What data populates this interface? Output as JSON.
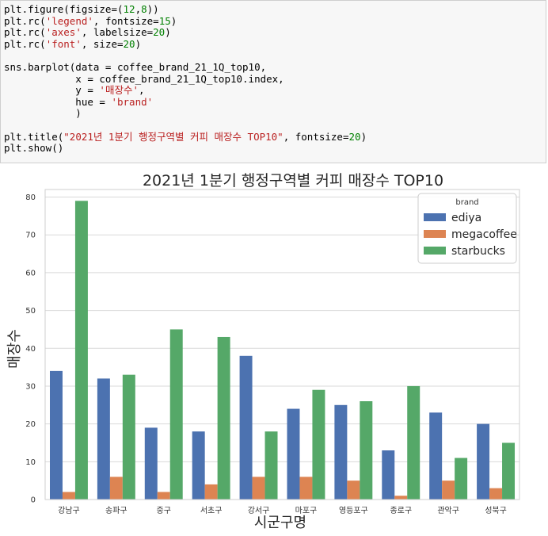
{
  "code_cell": {
    "lines": [
      [
        {
          "t": "plt.figure(figsize=("
        },
        {
          "t": "12",
          "c": "num"
        },
        {
          "t": ","
        },
        {
          "t": "8",
          "c": "num"
        },
        {
          "t": "))"
        }
      ],
      [
        {
          "t": "plt.rc("
        },
        {
          "t": "'legend'",
          "c": "str"
        },
        {
          "t": ", fontsize="
        },
        {
          "t": "15",
          "c": "num"
        },
        {
          "t": ")"
        }
      ],
      [
        {
          "t": "plt.rc("
        },
        {
          "t": "'axes'",
          "c": "str"
        },
        {
          "t": ", labelsize="
        },
        {
          "t": "20",
          "c": "num"
        },
        {
          "t": ")"
        }
      ],
      [
        {
          "t": "plt.rc("
        },
        {
          "t": "'font'",
          "c": "str"
        },
        {
          "t": ", size="
        },
        {
          "t": "20",
          "c": "num"
        },
        {
          "t": ")"
        }
      ],
      [],
      [
        {
          "t": "sns.barplot(data = coffee_brand_21_1Q_top10,"
        }
      ],
      [
        {
          "t": "            x = coffee_brand_21_1Q_top10.index,"
        }
      ],
      [
        {
          "t": "            y = "
        },
        {
          "t": "'매장수'",
          "c": "str"
        },
        {
          "t": ","
        }
      ],
      [
        {
          "t": "            hue = "
        },
        {
          "t": "'brand'",
          "c": "str"
        }
      ],
      [
        {
          "t": "            )"
        }
      ],
      [],
      [
        {
          "t": "plt.title("
        },
        {
          "t": "\"2021년 1분기 행정구역별 커피 매장수 TOP10\"",
          "c": "str"
        },
        {
          "t": ", fontsize="
        },
        {
          "t": "20",
          "c": "num"
        },
        {
          "t": ")"
        }
      ],
      [
        {
          "t": "plt.show()"
        }
      ]
    ]
  },
  "colors": {
    "ediya": "#4c72b0",
    "megacoffee": "#dd8452",
    "starbucks": "#55a868",
    "grid": "#d9d9d9",
    "str": "#ba2121",
    "num": "#008000"
  },
  "chart_data": {
    "type": "bar",
    "title": "2021년 1분기 행정구역별 커피 매장수 TOP10",
    "xlabel": "시군구명",
    "ylabel": "매장수",
    "ylim": [
      0,
      82
    ],
    "yticks": [
      0,
      10,
      20,
      30,
      40,
      50,
      60,
      70,
      80
    ],
    "grid": true,
    "legend": {
      "title": "brand",
      "placement": "top-right"
    },
    "categories": [
      "강남구",
      "송파구",
      "중구",
      "서초구",
      "강서구",
      "마포구",
      "영등포구",
      "종로구",
      "관악구",
      "성북구"
    ],
    "series": [
      {
        "name": "ediya",
        "values": [
          34,
          32,
          19,
          18,
          38,
          24,
          25,
          13,
          23,
          20
        ]
      },
      {
        "name": "megacoffee",
        "values": [
          2,
          6,
          2,
          4,
          6,
          6,
          5,
          1,
          5,
          3
        ]
      },
      {
        "name": "starbucks",
        "values": [
          79,
          33,
          45,
          43,
          18,
          29,
          26,
          30,
          11,
          15
        ]
      }
    ]
  }
}
